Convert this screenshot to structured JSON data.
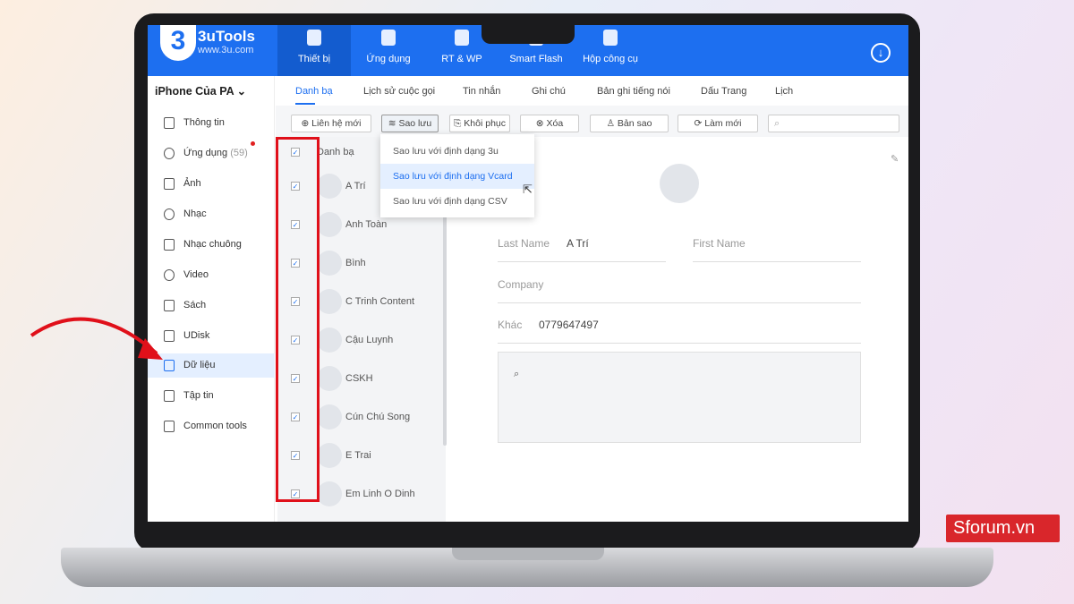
{
  "app": {
    "brand": "3uTools",
    "brand_logo": "3",
    "site": "www.3u.com"
  },
  "nav": [
    {
      "label": "Thiết bị"
    },
    {
      "label": "Ứng dụng"
    },
    {
      "label": "RT & WP"
    },
    {
      "label": "Smart Flash"
    },
    {
      "label": "Hộp công cụ"
    }
  ],
  "device": "iPhone Của PA ⌄",
  "sidebar": [
    {
      "label": "Thông tin"
    },
    {
      "label": "Ứng dụng",
      "badge": "(59)"
    },
    {
      "label": "Ảnh"
    },
    {
      "label": "Nhạc"
    },
    {
      "label": "Nhạc chuông"
    },
    {
      "label": "Video"
    },
    {
      "label": "Sách"
    },
    {
      "label": "UDisk"
    },
    {
      "label": "Dữ liệu"
    },
    {
      "label": "Tập tin"
    },
    {
      "label": "Common tools"
    }
  ],
  "tabs": [
    {
      "label": "Danh bạ"
    },
    {
      "label": "Lịch sử cuộc gọi"
    },
    {
      "label": "Tin nhắn"
    },
    {
      "label": "Ghi chú"
    },
    {
      "label": "Bản ghi tiếng nói"
    },
    {
      "label": "Dấu Trang"
    },
    {
      "label": "Lịch"
    }
  ],
  "toolbar": [
    {
      "label": "⊕ Liên hệ mới"
    },
    {
      "label": "≋ Sao lưu"
    },
    {
      "label": "⎘ Khôi phục"
    },
    {
      "label": "⊗ Xóa"
    },
    {
      "label": "♙ Bản sao"
    },
    {
      "label": "⟳ Làm mới"
    }
  ],
  "search_icon": "⌕",
  "list_header": "Danh bạ",
  "contacts": [
    {
      "name": "A Trí"
    },
    {
      "name": "Anh Toàn"
    },
    {
      "name": "Bình"
    },
    {
      "name": "C Trinh Content"
    },
    {
      "name": "Cậu Luynh"
    },
    {
      "name": "CSKH"
    },
    {
      "name": "Cún Chú Song"
    },
    {
      "name": "E Trai"
    },
    {
      "name": "Em Linh O Dinh"
    }
  ],
  "menu": [
    {
      "label": "Sao lưu với định dạng 3u"
    },
    {
      "label": "Sao lưu với định dạng Vcard"
    },
    {
      "label": "Sao lưu với định dạng CSV"
    }
  ],
  "detail": {
    "last_name_label": "Last Name",
    "last_name": "A Trí",
    "first_name_label": "First Name",
    "company_label": "Company",
    "other_label": "Khác",
    "other_value": "0779647497",
    "note_icon": "⌕"
  },
  "watermark": "Sforum.vn"
}
